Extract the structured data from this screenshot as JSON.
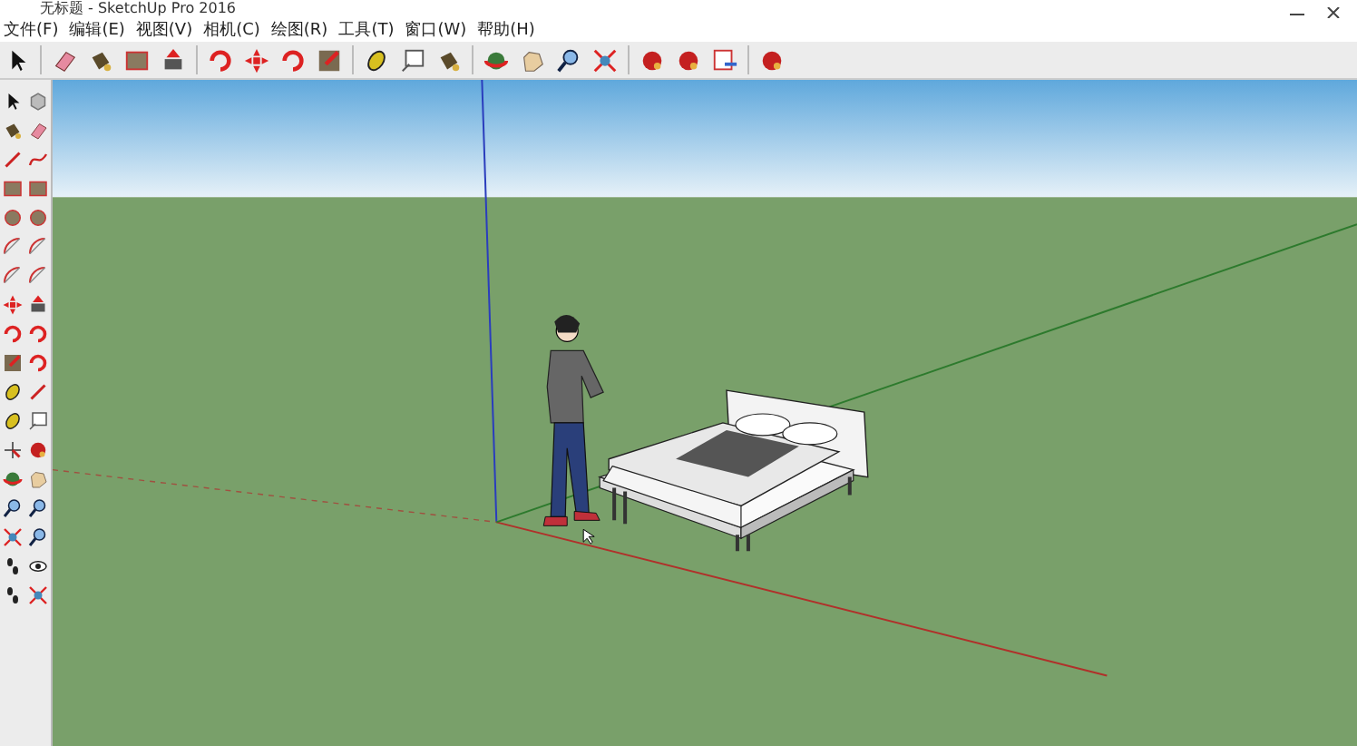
{
  "window": {
    "title": "无标题 - SketchUp Pro 2016"
  },
  "menu": [
    "文件(F)",
    "编辑(E)",
    "视图(V)",
    "相机(C)",
    "绘图(R)",
    "工具(T)",
    "窗口(W)",
    "帮助(H)"
  ]
}
